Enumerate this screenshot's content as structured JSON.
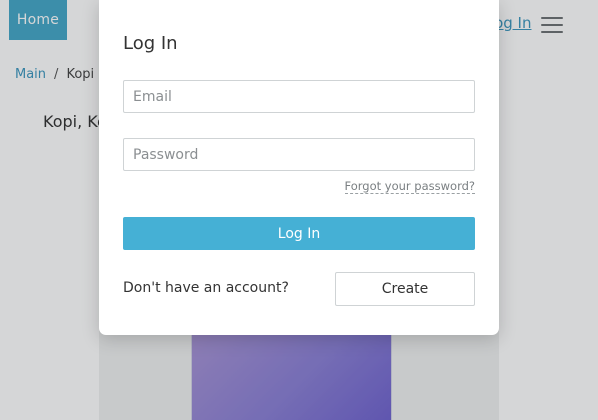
{
  "header": {
    "home_label": "Home",
    "login_link": "Log In"
  },
  "breadcrumb": {
    "items": [
      "Main",
      "Kopi"
    ],
    "separator": "/"
  },
  "product": {
    "title": "Kopi, Ke"
  },
  "modal": {
    "title": "Log In",
    "email_placeholder": "Email",
    "password_placeholder": "Password",
    "forgot_label": "Forgot your password?",
    "submit_label": "Log In",
    "no_account_text": "Don't have an account?",
    "create_label": "Create"
  },
  "icons": {
    "menu": "hamburger-menu-icon"
  },
  "colors": {
    "accent": "#45b0d5",
    "home_bg": "#45a8c8",
    "link": "#3c97bf"
  }
}
